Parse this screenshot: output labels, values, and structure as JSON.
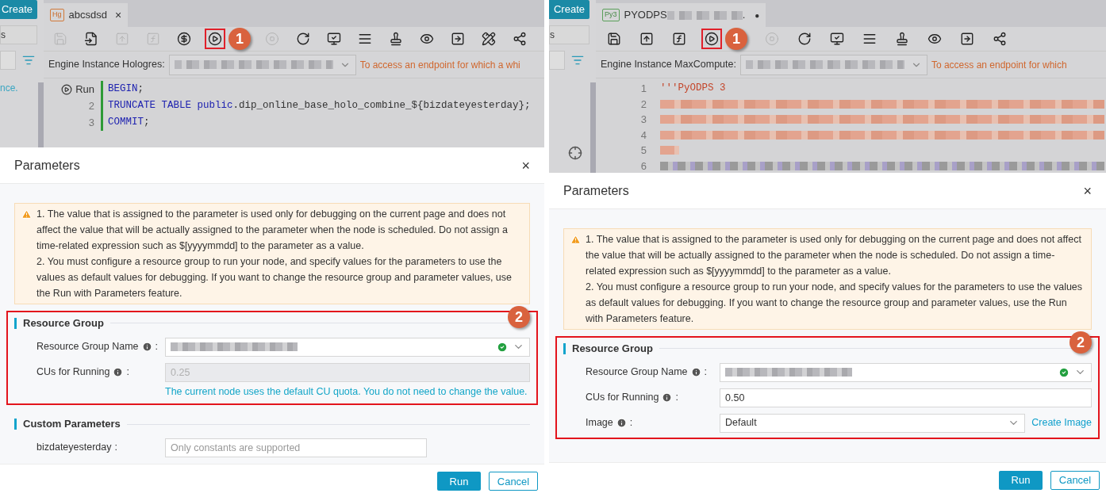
{
  "panels": [
    {
      "editor": {
        "sidebar": [
          {
            "kind": "button",
            "text": "Create"
          },
          {
            "kind": "field",
            "text": "s"
          },
          {
            "kind": "search"
          },
          {
            "kind": "link",
            "text": "nce."
          }
        ],
        "tab": {
          "badge": "Hg",
          "kind": "sql",
          "parts": [
            {
              "kind": "text",
              "text": "abcsdsd"
            }
          ],
          "close": "×"
        },
        "toolbar": [
          {
            "kind": "save",
            "disabled": true,
            "highlighted": false
          },
          {
            "kind": "save-as",
            "disabled": false,
            "highlighted": false
          },
          {
            "kind": "submit",
            "disabled": true,
            "highlighted": false
          },
          {
            "kind": "deploy",
            "disabled": true,
            "highlighted": false
          },
          {
            "kind": "cost",
            "disabled": false,
            "highlighted": false
          },
          {
            "kind": "run",
            "disabled": false,
            "highlighted": true,
            "callout": "1"
          },
          {
            "kind": "stop",
            "disabled": true,
            "highlighted": false
          },
          {
            "kind": "refresh",
            "disabled": false,
            "highlighted": false
          },
          {
            "kind": "check",
            "disabled": false,
            "highlighted": false
          },
          {
            "kind": "format",
            "disabled": false,
            "highlighted": false
          },
          {
            "kind": "stamp",
            "disabled": false,
            "highlighted": false
          },
          {
            "kind": "preview",
            "disabled": false,
            "highlighted": false
          },
          {
            "kind": "export",
            "disabled": false,
            "highlighted": false
          },
          {
            "kind": "tools",
            "disabled": false,
            "highlighted": false
          },
          {
            "kind": "graph",
            "disabled": false,
            "highlighted": false
          }
        ],
        "engine": {
          "label": "Engine Instance Hologres:",
          "notice": "To access an endpoint for which a whi"
        },
        "lines": [
          {
            "gutter": "Run",
            "kind": "run",
            "segments": [
              {
                "kind": "keyword",
                "text": "BEGIN"
              },
              {
                "kind": "plain",
                "text": ";"
              }
            ]
          },
          {
            "gutter": "2",
            "kind": "code",
            "segments": [
              {
                "kind": "keyword",
                "text": "TRUNCATE TABLE public"
              },
              {
                "kind": "plain",
                "text": ".dip_online_base_holo_combine_${bizdateyesterday};"
              }
            ]
          },
          {
            "gutter": "3",
            "kind": "code",
            "segments": [
              {
                "kind": "keyword",
                "text": "COMMIT"
              },
              {
                "kind": "plain",
                "text": ";"
              }
            ]
          }
        ]
      },
      "dialog": {
        "title": "Parameters",
        "close": "×",
        "notices": [
          "1. The value that is assigned to the parameter is used only for debugging on the current page and does not affect the value that will be actually assigned to the parameter when the node is scheduled. Do not assign a time-related expression such as $[yyyymmdd] to the parameter as a value.",
          "2. You must configure a resource group to run your node, and specify values for the parameters to use the values as default values for debugging. If you want to change the resource group and parameter values, use the Run with Parameters feature."
        ],
        "sections": [
          {
            "title": "Resource Group",
            "highlighted": true,
            "callout": "2",
            "fields": [
              {
                "label": "Resource Group Name",
                "info": true,
                "colon": ":",
                "kind": "select",
                "valid": true
              },
              {
                "label": "CUs for Running",
                "info": true,
                "colon": ":",
                "kind": "input",
                "value": "0.25",
                "disabled": true,
                "hint": "The current node uses the default CU quota. You do not need to change the value."
              }
            ]
          },
          {
            "title": "Custom Parameters",
            "highlighted": false,
            "fields": [
              {
                "label": "bizdateyesterday",
                "info": false,
                "colon": ":",
                "kind": "input",
                "placeholder": "Only constants are supported",
                "disabled": false
              }
            ]
          }
        ],
        "buttons": [
          {
            "label": "Run",
            "kind": "primary"
          },
          {
            "label": "Cancel",
            "kind": "secondary"
          }
        ]
      }
    },
    {
      "editor": {
        "sidebar": [
          {
            "kind": "button",
            "text": "Create"
          },
          {
            "kind": "field",
            "text": "s"
          },
          {
            "kind": "search"
          },
          {
            "kind": "locate"
          }
        ],
        "tab": {
          "badge": "Py3",
          "kind": "python",
          "parts": [
            {
              "kind": "text",
              "text": "PYODPS"
            },
            {
              "kind": "redacted"
            },
            {
              "kind": "text",
              "text": "."
            }
          ],
          "modified": "●"
        },
        "toolbar": [
          {
            "kind": "save",
            "disabled": false,
            "highlighted": false
          },
          {
            "kind": "submit",
            "disabled": false,
            "highlighted": false
          },
          {
            "kind": "deploy",
            "disabled": false,
            "highlighted": false
          },
          {
            "kind": "run",
            "disabled": false,
            "highlighted": true,
            "callout": "1"
          },
          {
            "kind": "stop",
            "disabled": true,
            "highlighted": false
          },
          {
            "kind": "refresh",
            "disabled": false,
            "highlighted": false
          },
          {
            "kind": "check",
            "disabled": false,
            "highlighted": false
          },
          {
            "kind": "format",
            "disabled": false,
            "highlighted": false
          },
          {
            "kind": "stamp",
            "disabled": false,
            "highlighted": false
          },
          {
            "kind": "preview",
            "disabled": false,
            "highlighted": false
          },
          {
            "kind": "export",
            "disabled": false,
            "highlighted": false
          },
          {
            "kind": "graph",
            "disabled": false,
            "highlighted": false
          }
        ],
        "engine": {
          "label": "Engine Instance MaxCompute:",
          "notice": "To access an endpoint for which"
        },
        "lines": [
          {
            "gutter": "1",
            "kind": "code",
            "segments": [
              {
                "kind": "string",
                "text": "'''PyODPS 3"
              }
            ]
          },
          {
            "gutter": "2",
            "kind": "redacted-string"
          },
          {
            "gutter": "3",
            "kind": "redacted-string"
          },
          {
            "gutter": "4",
            "kind": "redacted-string"
          },
          {
            "gutter": "5",
            "kind": "redacted-short"
          },
          {
            "gutter": "6",
            "kind": "redacted-plain"
          }
        ]
      },
      "dialog": {
        "title": "Parameters",
        "close": "×",
        "notices": [
          "1. The value that is assigned to the parameter is used only for debugging on the current page and does not affect the value that will be actually assigned to the parameter when the node is scheduled. Do not assign a time-related expression such as $[yyyymmdd] to the parameter as a value.",
          "2. You must configure a resource group to run your node, and specify values for the parameters to use the values as default values for debugging. If you want to change the resource group and parameter values, use the Run with Parameters feature."
        ],
        "sections": [
          {
            "title": "Resource Group",
            "highlighted": true,
            "callout": "2",
            "fields": [
              {
                "label": "Resource Group Name",
                "info": true,
                "colon": ":",
                "kind": "select",
                "valid": true
              },
              {
                "label": "CUs for Running",
                "info": true,
                "colon": ":",
                "kind": "input",
                "value": "0.50",
                "disabled": false
              },
              {
                "label": "Image",
                "info": true,
                "colon": ":",
                "kind": "select",
                "value": "Default",
                "link": "Create Image"
              }
            ]
          }
        ],
        "buttons": [
          {
            "label": "Run",
            "kind": "primary"
          },
          {
            "label": "Cancel",
            "kind": "secondary"
          }
        ]
      }
    }
  ]
}
